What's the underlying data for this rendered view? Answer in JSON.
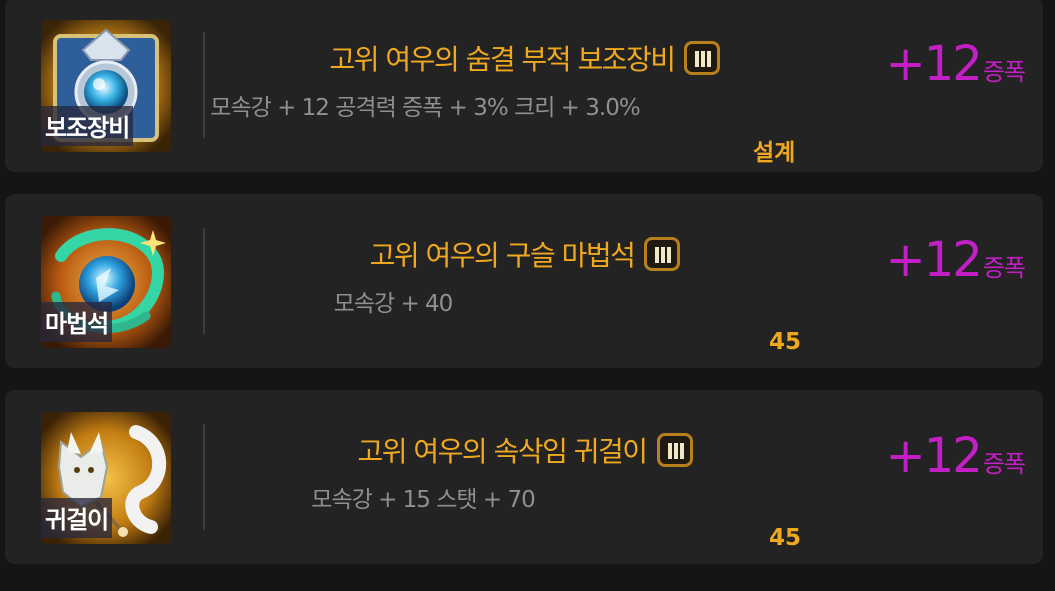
{
  "items": [
    {
      "icon_name": "secondary-weapon-icon",
      "icon_label": "보조장비",
      "title": "고위 여우의 숨결 부적 보조장비",
      "grade": "III",
      "stats": "모속강 + 12 공격력 증폭 + 3% 크리 + 3.0%",
      "note": "설계",
      "score_value": "+12",
      "score_unit": "증폭"
    },
    {
      "icon_name": "magic-stone-icon",
      "icon_label": "마법석",
      "title": "고위 여우의 구슬 마법석",
      "grade": "III",
      "stats": "모속강 + 40",
      "note": "45",
      "score_value": "+12",
      "score_unit": "증폭"
    },
    {
      "icon_name": "earring-icon",
      "icon_label": "귀걸이",
      "title": "고위 여우의 속삭임 귀걸이",
      "grade": "III",
      "stats": "모속강 + 15 스탯 + 70",
      "note": "45",
      "score_value": "+12",
      "score_unit": "증폭"
    }
  ],
  "colors": {
    "background": "#151515",
    "card": "#232323",
    "title": "#f0a91f",
    "stats": "#8f8f8f",
    "score": "#c21fc6",
    "grade_border": "#b8801c"
  }
}
